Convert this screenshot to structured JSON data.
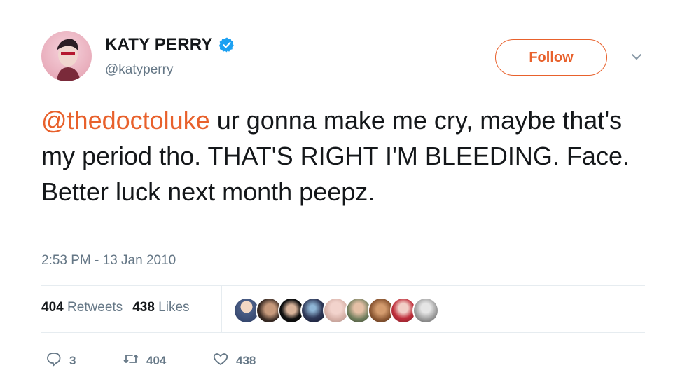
{
  "user": {
    "name": "KATY PERRY",
    "handle": "@katyperry",
    "verified": true
  },
  "follow_button": {
    "label": "Follow"
  },
  "tweet": {
    "mention": "@thedoctoluke",
    "text": " ur gonna make me cry, maybe that's my period tho. THAT'S RIGHT I'M BLEEDING. Face. Better luck next month peepz.",
    "timestamp": "2:53 PM - 13 Jan 2010"
  },
  "stats": {
    "retweets_count": "404",
    "retweets_label": "Retweets",
    "likes_count": "438",
    "likes_label": "Likes"
  },
  "actions": {
    "reply_count": "3",
    "retweet_count": "404",
    "like_count": "438"
  },
  "colors": {
    "accent": "#e8612c",
    "verified": "#1da1f2",
    "secondary_text": "#657786"
  }
}
